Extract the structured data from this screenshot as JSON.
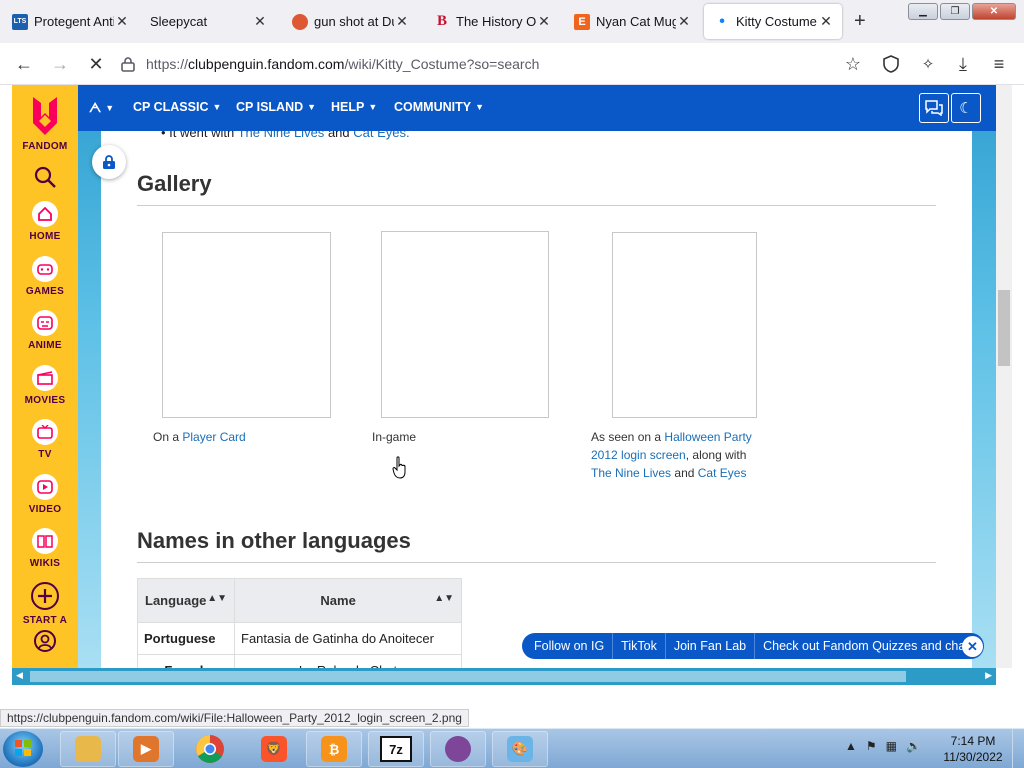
{
  "browser": {
    "tabs": [
      {
        "title": "Protegent Antivi",
        "favicon": "protegent-icon",
        "favicon_text": "LTS",
        "favicon_color": "#1b5fae"
      },
      {
        "title": "Sleepycat",
        "favicon": "blank-icon",
        "favicon_text": "",
        "favicon_color": "#f0f0f4"
      },
      {
        "title": "gun shot at Duc",
        "favicon": "duckduckgo-icon",
        "favicon_text": "",
        "favicon_color": "#de5833"
      },
      {
        "title": "The History Of",
        "favicon": "b-site-icon",
        "favicon_text": "B",
        "favicon_color": "#c8102e"
      },
      {
        "title": "Nyan Cat Mug",
        "favicon": "etsy-icon",
        "favicon_text": "E",
        "favicon_color": "#f1641e"
      },
      {
        "title": "Kitty Costume |",
        "favicon": "loading-dot-icon",
        "favicon_text": "•",
        "favicon_color": "#0a84ff"
      }
    ],
    "url_prefix": "https://",
    "url_host": "clubpenguin.fandom.com",
    "url_path": "/wiki/Kitty_Costume?so=search",
    "status_url": "https://clubpenguin.fandom.com/wiki/File:Halloween_Party_2012_login_screen_2.png"
  },
  "rail": {
    "brand": "FANDOM",
    "items": [
      {
        "label": "HOME",
        "icon": "home-icon"
      },
      {
        "label": "GAMES",
        "icon": "gamepad-icon"
      },
      {
        "label": "ANIME",
        "icon": "anime-icon"
      },
      {
        "label": "MOVIES",
        "icon": "clapperboard-icon"
      },
      {
        "label": "TV",
        "icon": "tv-icon"
      },
      {
        "label": "VIDEO",
        "icon": "video-icon"
      },
      {
        "label": "WIKIS",
        "icon": "book-icon"
      },
      {
        "label": "START A",
        "icon": "plus-circle-icon"
      }
    ]
  },
  "wiki": {
    "nav": [
      "CP CLASSIC",
      "CP ISLAND",
      "HELP",
      "COMMUNITY"
    ],
    "bullet": {
      "prefix": "It went with",
      "link1": "The Nine Lives",
      "middle": "and",
      "link2": "Cat Eyes",
      "suffix": "."
    },
    "gallery_heading": "Gallery",
    "captions": {
      "c1_prefix": "On a",
      "c1_link": "Player Card",
      "c2": "In-game",
      "c3_prefix": "As seen on a",
      "c3_link1": "Halloween Party 2012 login screen",
      "c3_mid": ", along with",
      "c3_link2": "The Nine Lives",
      "c3_and": "and",
      "c3_link3": "Cat Eyes"
    },
    "languages_heading": "Names in other languages",
    "table": {
      "headers": [
        "Language",
        "Name"
      ],
      "rows": [
        [
          "Portuguese",
          "Fantasia de Gatinha do Anoitecer"
        ],
        [
          "French",
          "La Robe de Chat"
        ]
      ]
    },
    "follow_bar": [
      "Follow on IG",
      "TikTok",
      "Join Fan Lab",
      "Check out Fandom Quizzes and cha"
    ]
  },
  "taskbar": {
    "apps": [
      {
        "name": "explorer-icon",
        "color": "#e8b84a"
      },
      {
        "name": "media-player-icon",
        "color": "#e0762b"
      },
      {
        "name": "chrome-icon",
        "color": "#db4437"
      },
      {
        "name": "brave-icon",
        "color": "#fb542b"
      },
      {
        "name": "bitcoin-app-icon",
        "color": "#f7931a"
      },
      {
        "name": "7zip-icon",
        "color": "#111111"
      },
      {
        "name": "tor-browser-icon",
        "color": "#7d4698"
      },
      {
        "name": "paint-icon",
        "color": "#6bb4e8"
      }
    ],
    "seven_zip_label": "7z",
    "time": "7:14 PM",
    "date": "11/30/2022"
  }
}
